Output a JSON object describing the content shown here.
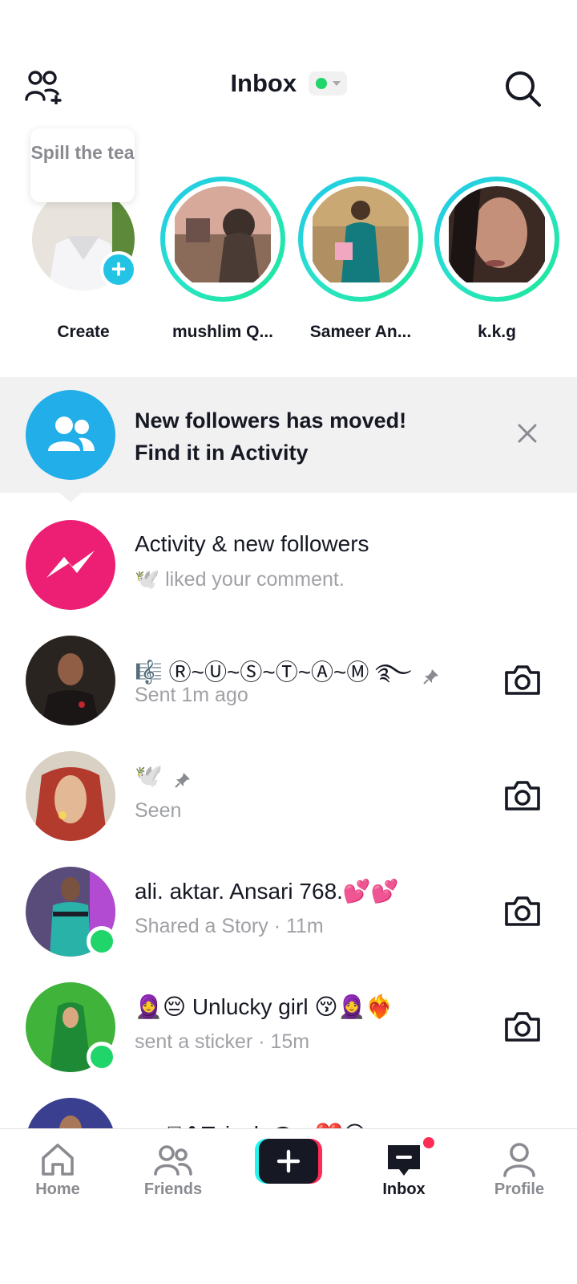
{
  "header": {
    "title": "Inbox",
    "status": "online"
  },
  "stories": {
    "bubble": "Spill the tea",
    "items": [
      {
        "name": "Create"
      },
      {
        "name": "mushlim Q..."
      },
      {
        "name": "Sameer An..."
      },
      {
        "name": "k.k.g"
      }
    ]
  },
  "banner": {
    "line1": "New followers has moved!",
    "line2": "Find it in Activity"
  },
  "activity": {
    "title": "Activity & new followers",
    "subtitle": "🕊️ liked your comment."
  },
  "chats": [
    {
      "name": "🎼 Ⓡ~Ⓤ~Ⓢ~Ⓣ~Ⓐ~Ⓜ ࿐",
      "status": "Sent 1m ago",
      "pinned": true,
      "online": false
    },
    {
      "name": "🕊️",
      "status": "Seen",
      "pinned": true,
      "online": false
    },
    {
      "name": "ali. aktar.  Ansari  768.💕💕",
      "status": "Shared a Story · 11m",
      "pinned": false,
      "online": true
    },
    {
      "name": "🧕😔 Unlucky girl 😚🧕❤️‍🔥",
      "status": "sent a sticker · 15m",
      "pinned": false,
      "online": true
    },
    {
      "name": "me⃝✿Taiyab ࿐ ❤️😘",
      "status": "",
      "pinned": false,
      "online": false
    }
  ],
  "nav": {
    "home": "Home",
    "friends": "Friends",
    "inbox": "Inbox",
    "profile": "Profile"
  },
  "colors": {
    "accent": "#fe2c55",
    "story_ring": "#20c6ee",
    "online": "#20d56a",
    "banner_icon": "#22aee8",
    "activity_icon": "#ec1f74"
  }
}
